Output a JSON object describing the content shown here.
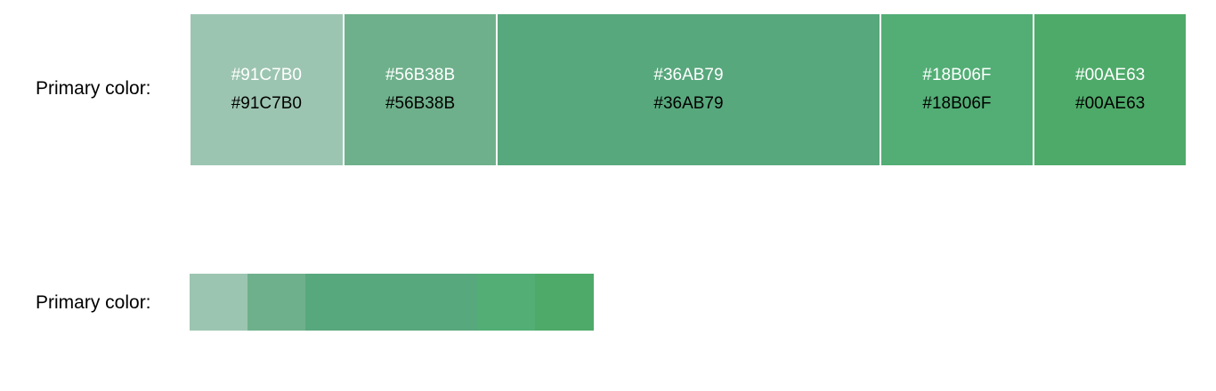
{
  "rows": [
    {
      "label": "Primary color:"
    },
    {
      "label": "Primary color:"
    }
  ],
  "swatches": [
    {
      "hex": "#91C7B0",
      "text": "#91C7B0",
      "color": "#9CC5B1"
    },
    {
      "hex": "#56B38B",
      "text": "#56B38B",
      "color": "#6EB08B"
    },
    {
      "hex": "#36AB79",
      "text": "#36AB79",
      "color": "#58A87D"
    },
    {
      "hex": "#18B06F",
      "text": "#18B06F",
      "color": "#52AE75"
    },
    {
      "hex": "#00AE63",
      "text": "#00AE63",
      "color": "#4EAA69"
    }
  ]
}
